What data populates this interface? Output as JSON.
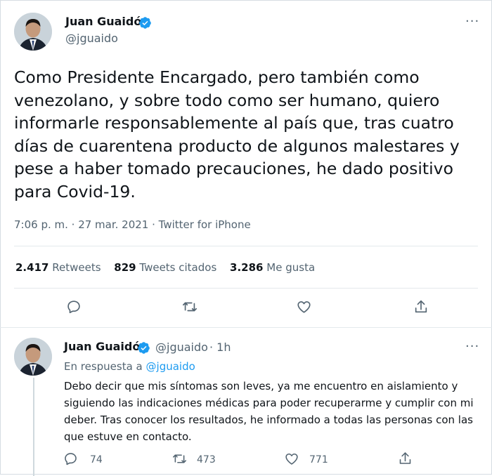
{
  "tweet": {
    "author_name": "Juan Guaidó",
    "author_handle": "@jguaido",
    "text": "Como Presidente Encargado, pero también como venezolano, y sobre todo como ser humano, quiero informarle responsablemente al país que, tras cuatro días de cuarentena producto de algunos malestares y pese a haber tomado precauciones, he dado positivo para Covid-19.",
    "timestamp": "7:06 p. m. · 27 mar. 2021 · Twitter for iPhone",
    "stats": {
      "retweets_count": "2.417",
      "retweets_label": "Retweets",
      "quotes_count": "829",
      "quotes_label": "Tweets citados",
      "likes_count": "3.286",
      "likes_label": "Me gusta"
    },
    "actions": [
      "reply-icon",
      "retweet-icon",
      "like-icon",
      "share-icon"
    ]
  },
  "reply": {
    "author_name": "Juan Guaidó",
    "author_handle": "@jguaido",
    "time_ago": "· 1h",
    "in_reply_prefix": "En respuesta a",
    "in_reply_handle": "@jguaido",
    "text": "Debo decir que mis síntomas son leves, ya me encuentro en aislamiento y siguiendo las indicaciones médicas para poder recuperarme y cumplir con mi deber. Tras conocer los resultados, he informado a todas las personas con las que estuve en contacto.",
    "counts": {
      "replies": "74",
      "retweets": "473",
      "likes": "771"
    }
  },
  "colors": {
    "accent": "#1d9bf0",
    "text": "#0f1419",
    "secondary": "#536471",
    "border": "#e4e9ec"
  }
}
